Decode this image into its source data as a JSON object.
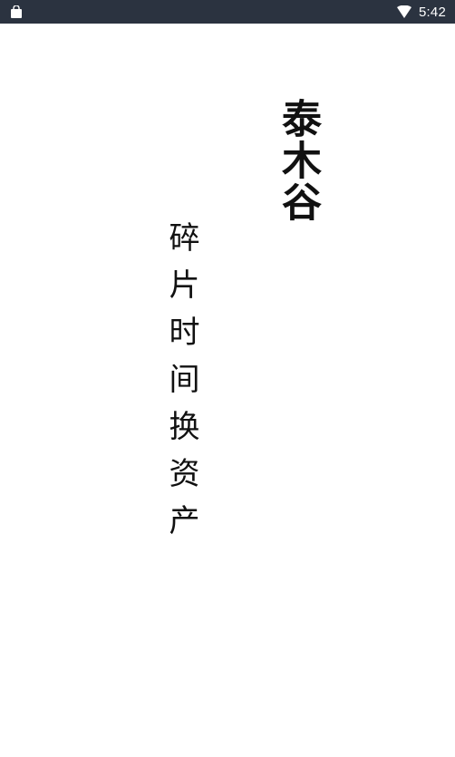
{
  "status_bar": {
    "left_icon": "shopping-bag-icon",
    "wifi_icon": "wifi-icon",
    "time": "5:42"
  },
  "splash": {
    "brand_title": "泰木谷",
    "slogan": "碎片时间换资产"
  },
  "colors": {
    "status_bar_bg": "#2b3340",
    "background": "#ffffff",
    "text": "#111111"
  }
}
